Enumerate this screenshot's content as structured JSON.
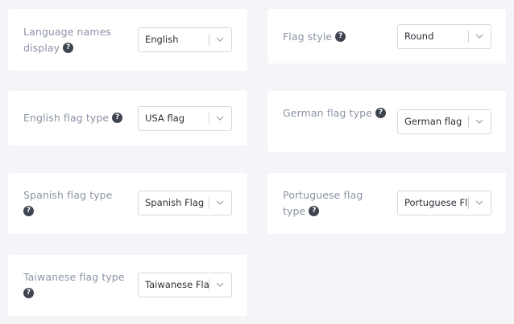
{
  "settings": [
    {
      "id": "language_names_display",
      "label": "Language names display",
      "value": "English"
    },
    {
      "id": "flag_style",
      "label": "Flag style",
      "value": "Round"
    },
    {
      "id": "english_flag_type",
      "label": "English flag type",
      "value": "USA flag"
    },
    {
      "id": "german_flag_type",
      "label": "German flag type",
      "value": "German flag"
    },
    {
      "id": "spanish_flag_type",
      "label": "Spanish flag type",
      "value": "Spanish Flag"
    },
    {
      "id": "portuguese_flag_type",
      "label": "Portuguese flag type",
      "value": "Portuguese Fl..."
    },
    {
      "id": "taiwanese_flag_type",
      "label": "Taiwanese flag type",
      "value": "Taiwanese Flag"
    }
  ],
  "help_glyph": "?",
  "icons": {
    "help": "question-circle-icon",
    "dropdown": "chevron-down-icon"
  },
  "colors": {
    "background": "#f4f5f9",
    "card": "#ffffff",
    "label": "#8b93a4",
    "value": "#2b2f36",
    "help_icon": "#3f4550",
    "border": "#d6d9de"
  }
}
